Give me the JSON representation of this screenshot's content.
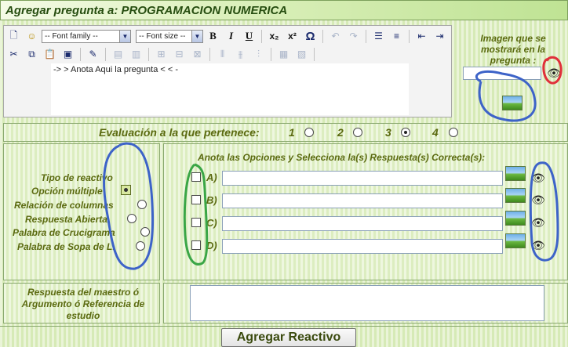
{
  "header": {
    "title": "Agregar pregunta a: PROGRAMACION NUMERICA"
  },
  "editor": {
    "font_family_placeholder": "-- Font family --",
    "font_size_placeholder": "-- Font size --",
    "bold": "B",
    "italic": "I",
    "underline": "U",
    "subscript": "x₂",
    "superscript": "x²",
    "omega": "Ω",
    "content": "-> > Anota Aqui la pregunta < < -"
  },
  "image_section": {
    "label": "Imagen que se mostrará en la pregunta :"
  },
  "evaluation": {
    "label": "Evaluación a la que pertenece:",
    "options": [
      "1",
      "2",
      "3",
      "4"
    ],
    "selected": "3"
  },
  "tipo": {
    "title": "Tipo de reactivo",
    "items": [
      "Opción múltiple",
      "Relación de columnas",
      "Respuesta Abierta",
      "Palabra de Crucigrama",
      "Palabra de Sopa de L."
    ],
    "selected": "Opción múltiple"
  },
  "options_section": {
    "header": "Anota las Opciones y Selecciona la(s) Respuesta(s) Correcta(s):",
    "letters": [
      "A)",
      "B)",
      "C)",
      "D)"
    ]
  },
  "respuesta": {
    "label": "Respuesta del maestro ó Argumento ó Referencia de estudio"
  },
  "submit": {
    "label": "Agregar Reactivo"
  },
  "colors": {
    "title_text": "#264d10",
    "olive_text": "#5b6a10",
    "blue_mark": "#3d63c8",
    "green_mark": "#3aa646",
    "red_mark": "#e0303a"
  }
}
